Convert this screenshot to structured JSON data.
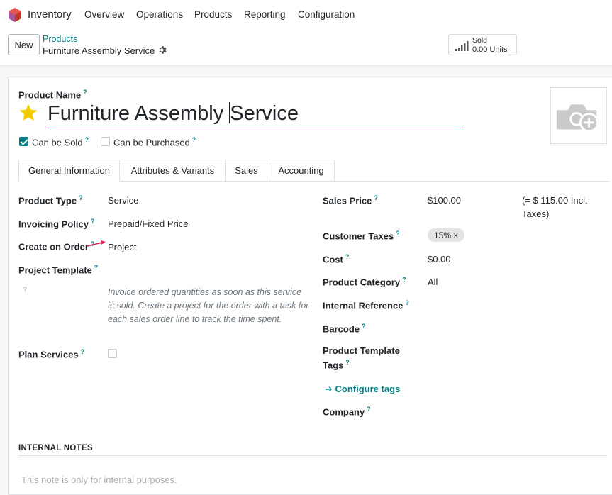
{
  "navbar": {
    "app_name": "Inventory",
    "menu": [
      "Overview",
      "Operations",
      "Products",
      "Reporting",
      "Configuration"
    ]
  },
  "control": {
    "new_label": "New",
    "breadcrumb_parent": "Products",
    "breadcrumb_current": "Furniture Assembly Service",
    "smart_button": {
      "label": "Sold",
      "value": "0.00 Units"
    }
  },
  "form": {
    "product_name_label": "Product Name",
    "product_name_before_caret": "Furniture Assembly ",
    "product_name_after_caret": "Service",
    "can_be_sold_label": "Can be Sold",
    "can_be_sold_checked": true,
    "can_be_purchased_label": "Can be Purchased",
    "can_be_purchased_checked": false,
    "help_mark": "?"
  },
  "tabs": [
    "General Information",
    "Attributes & Variants",
    "Sales",
    "Accounting"
  ],
  "left_fields": {
    "product_type": {
      "label": "Product Type",
      "value": "Service"
    },
    "invoicing_policy": {
      "label": "Invoicing Policy",
      "value": "Prepaid/Fixed Price"
    },
    "create_on_order": {
      "label": "Create on Order",
      "value": "Project"
    },
    "project_template": {
      "label": "Project Template",
      "value": ""
    },
    "help_text": "Invoice ordered quantities as soon as this service is sold. Create a project for the order with a task for each sales order line to track the time spent.",
    "plan_services": {
      "label": "Plan Services",
      "checked": false
    }
  },
  "right_fields": {
    "sales_price": {
      "label": "Sales Price",
      "value": "$100.00",
      "incl_line1": "(= $ 115.00 Incl.",
      "incl_line2": "Taxes)"
    },
    "customer_taxes": {
      "label": "Customer Taxes",
      "tag": "15% ×"
    },
    "cost": {
      "label": "Cost",
      "value": "$0.00"
    },
    "product_category": {
      "label": "Product Category",
      "value": "All"
    },
    "internal_reference": {
      "label": "Internal Reference"
    },
    "barcode": {
      "label": "Barcode"
    },
    "product_template_tags": {
      "label_line1": "Product Template",
      "label_line2": "Tags"
    },
    "configure_tags": "Configure tags",
    "company": {
      "label": "Company"
    }
  },
  "notes": {
    "title": "INTERNAL NOTES",
    "placeholder": "This note is only for internal purposes."
  },
  "colors": {
    "accent": "#017e84",
    "star": "#f3cc00",
    "arrow": "#e0245e"
  }
}
